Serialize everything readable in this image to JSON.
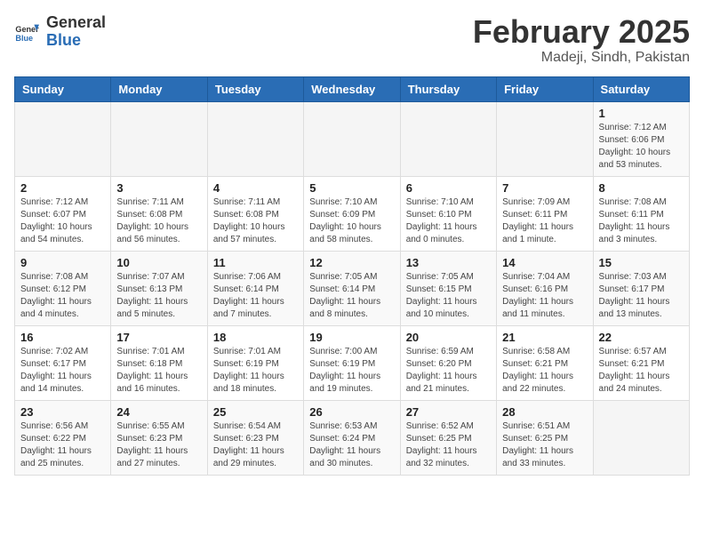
{
  "header": {
    "logo_general": "General",
    "logo_blue": "Blue",
    "month_title": "February 2025",
    "location": "Madeji, Sindh, Pakistan"
  },
  "days_of_week": [
    "Sunday",
    "Monday",
    "Tuesday",
    "Wednesday",
    "Thursday",
    "Friday",
    "Saturday"
  ],
  "weeks": [
    [
      {
        "day": "",
        "info": ""
      },
      {
        "day": "",
        "info": ""
      },
      {
        "day": "",
        "info": ""
      },
      {
        "day": "",
        "info": ""
      },
      {
        "day": "",
        "info": ""
      },
      {
        "day": "",
        "info": ""
      },
      {
        "day": "1",
        "info": "Sunrise: 7:12 AM\nSunset: 6:06 PM\nDaylight: 10 hours and 53 minutes."
      }
    ],
    [
      {
        "day": "2",
        "info": "Sunrise: 7:12 AM\nSunset: 6:07 PM\nDaylight: 10 hours and 54 minutes."
      },
      {
        "day": "3",
        "info": "Sunrise: 7:11 AM\nSunset: 6:08 PM\nDaylight: 10 hours and 56 minutes."
      },
      {
        "day": "4",
        "info": "Sunrise: 7:11 AM\nSunset: 6:08 PM\nDaylight: 10 hours and 57 minutes."
      },
      {
        "day": "5",
        "info": "Sunrise: 7:10 AM\nSunset: 6:09 PM\nDaylight: 10 hours and 58 minutes."
      },
      {
        "day": "6",
        "info": "Sunrise: 7:10 AM\nSunset: 6:10 PM\nDaylight: 11 hours and 0 minutes."
      },
      {
        "day": "7",
        "info": "Sunrise: 7:09 AM\nSunset: 6:11 PM\nDaylight: 11 hours and 1 minute."
      },
      {
        "day": "8",
        "info": "Sunrise: 7:08 AM\nSunset: 6:11 PM\nDaylight: 11 hours and 3 minutes."
      }
    ],
    [
      {
        "day": "9",
        "info": "Sunrise: 7:08 AM\nSunset: 6:12 PM\nDaylight: 11 hours and 4 minutes."
      },
      {
        "day": "10",
        "info": "Sunrise: 7:07 AM\nSunset: 6:13 PM\nDaylight: 11 hours and 5 minutes."
      },
      {
        "day": "11",
        "info": "Sunrise: 7:06 AM\nSunset: 6:14 PM\nDaylight: 11 hours and 7 minutes."
      },
      {
        "day": "12",
        "info": "Sunrise: 7:05 AM\nSunset: 6:14 PM\nDaylight: 11 hours and 8 minutes."
      },
      {
        "day": "13",
        "info": "Sunrise: 7:05 AM\nSunset: 6:15 PM\nDaylight: 11 hours and 10 minutes."
      },
      {
        "day": "14",
        "info": "Sunrise: 7:04 AM\nSunset: 6:16 PM\nDaylight: 11 hours and 11 minutes."
      },
      {
        "day": "15",
        "info": "Sunrise: 7:03 AM\nSunset: 6:17 PM\nDaylight: 11 hours and 13 minutes."
      }
    ],
    [
      {
        "day": "16",
        "info": "Sunrise: 7:02 AM\nSunset: 6:17 PM\nDaylight: 11 hours and 14 minutes."
      },
      {
        "day": "17",
        "info": "Sunrise: 7:01 AM\nSunset: 6:18 PM\nDaylight: 11 hours and 16 minutes."
      },
      {
        "day": "18",
        "info": "Sunrise: 7:01 AM\nSunset: 6:19 PM\nDaylight: 11 hours and 18 minutes."
      },
      {
        "day": "19",
        "info": "Sunrise: 7:00 AM\nSunset: 6:19 PM\nDaylight: 11 hours and 19 minutes."
      },
      {
        "day": "20",
        "info": "Sunrise: 6:59 AM\nSunset: 6:20 PM\nDaylight: 11 hours and 21 minutes."
      },
      {
        "day": "21",
        "info": "Sunrise: 6:58 AM\nSunset: 6:21 PM\nDaylight: 11 hours and 22 minutes."
      },
      {
        "day": "22",
        "info": "Sunrise: 6:57 AM\nSunset: 6:21 PM\nDaylight: 11 hours and 24 minutes."
      }
    ],
    [
      {
        "day": "23",
        "info": "Sunrise: 6:56 AM\nSunset: 6:22 PM\nDaylight: 11 hours and 25 minutes."
      },
      {
        "day": "24",
        "info": "Sunrise: 6:55 AM\nSunset: 6:23 PM\nDaylight: 11 hours and 27 minutes."
      },
      {
        "day": "25",
        "info": "Sunrise: 6:54 AM\nSunset: 6:23 PM\nDaylight: 11 hours and 29 minutes."
      },
      {
        "day": "26",
        "info": "Sunrise: 6:53 AM\nSunset: 6:24 PM\nDaylight: 11 hours and 30 minutes."
      },
      {
        "day": "27",
        "info": "Sunrise: 6:52 AM\nSunset: 6:25 PM\nDaylight: 11 hours and 32 minutes."
      },
      {
        "day": "28",
        "info": "Sunrise: 6:51 AM\nSunset: 6:25 PM\nDaylight: 11 hours and 33 minutes."
      },
      {
        "day": "",
        "info": ""
      }
    ]
  ]
}
